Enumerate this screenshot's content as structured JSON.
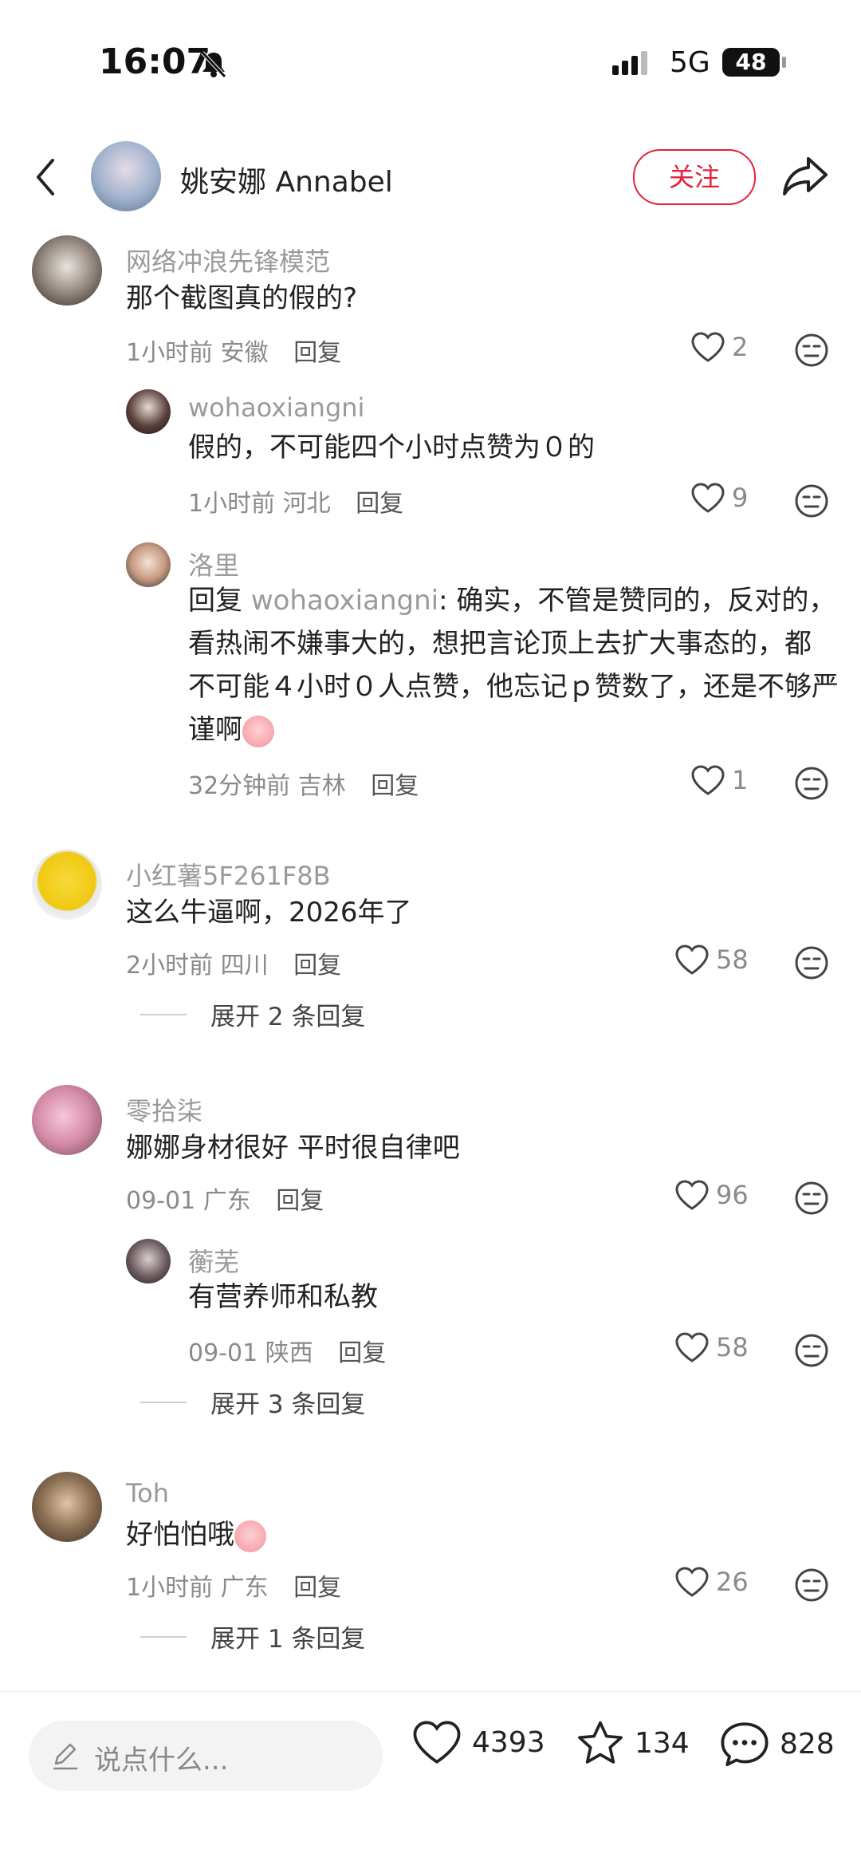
{
  "status_bar": {
    "time": "16:07",
    "network": "5G",
    "battery": "48"
  },
  "header": {
    "author_name": "姚安娜 Annabel",
    "follow_label": "关注"
  },
  "comments": [
    {
      "user": "网络冲浪先锋模范",
      "text": "那个截图真的假的?",
      "time": "1小时前",
      "location": "安徽",
      "reply_label": "回复",
      "likes": "2"
    },
    {
      "user": "wohaoxiangni",
      "text": "假的，不可能四个小时点赞为０的",
      "time": "1小时前",
      "location": "河北",
      "reply_label": "回复",
      "likes": "9"
    },
    {
      "user": "洛里",
      "reply_prefix": "回复 ",
      "mention": "wohaoxiangni",
      "line1": ": 确实，不管是赞同的，反对的，",
      "line2": "看热闹不嫌事大的，想把言论顶上去扩大事态的，都",
      "line3": "不可能４小时０人点赞，他忘记ｐ赞数了，还是不够严",
      "line4": "谨啊",
      "time": "32分钟前",
      "location": "吉林",
      "reply_label": "回复",
      "likes": "1"
    },
    {
      "user": "小红薯5F261F8B",
      "text": "这么牛逼啊，2026年了",
      "time": "2小时前",
      "location": "四川",
      "reply_label": "回复",
      "likes": "58",
      "expand": "展开 2 条回复"
    },
    {
      "user": "零拾柒",
      "text": "娜娜身材很好 平时很自律吧",
      "time": "09-01",
      "location": "广东",
      "reply_label": "回复",
      "likes": "96"
    },
    {
      "user": "蘅芜",
      "text": "有营养师和私教",
      "time": "09-01",
      "location": "陕西",
      "reply_label": "回复",
      "likes": "58",
      "expand": "展开 3 条回复"
    },
    {
      "user": "Toh",
      "text": "好怕怕哦",
      "time": "1小时前",
      "location": "广东",
      "reply_label": "回复",
      "likes": "26",
      "expand": "展开 1 条回复"
    }
  ],
  "bottom_bar": {
    "input_placeholder": "说点什么...",
    "likes": "4393",
    "stars": "134",
    "comments": "828"
  },
  "colors": {
    "accent": "#e3213b",
    "muted": "#9a9a9a"
  },
  "icons": [
    "back-icon",
    "share-icon",
    "heart-icon",
    "dislike-icon",
    "pencil-icon",
    "star-icon",
    "comment-bubble-icon"
  ]
}
